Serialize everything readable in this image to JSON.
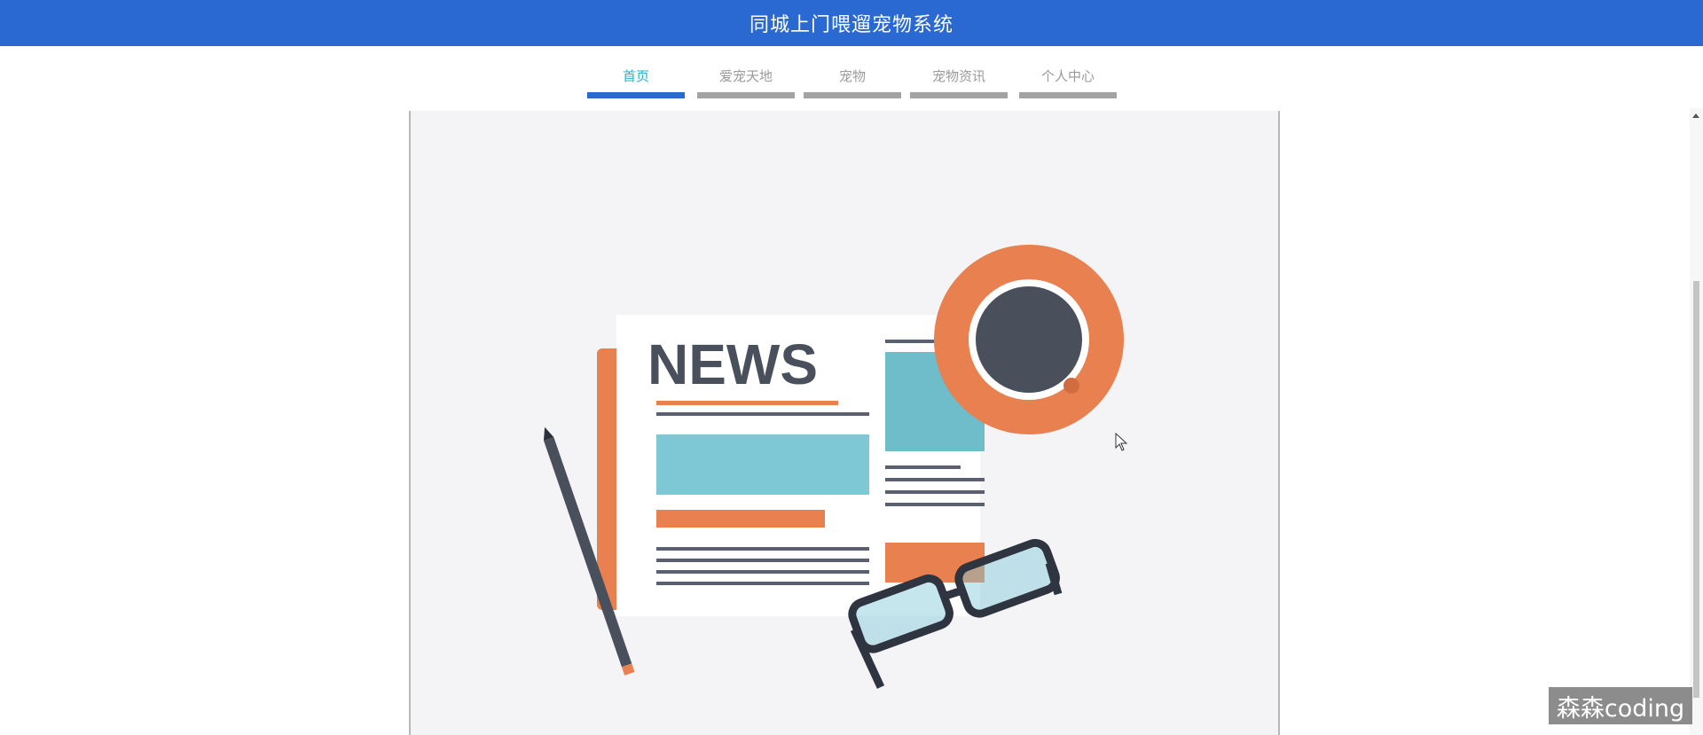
{
  "header": {
    "title": "同城上门喂遛宠物系统"
  },
  "nav": {
    "tabs": [
      {
        "label": "首页",
        "active": true
      },
      {
        "label": "爱宠天地",
        "active": false
      },
      {
        "label": "宠物",
        "active": false
      },
      {
        "label": "宠物资讯",
        "active": false
      },
      {
        "label": "个人中心",
        "active": false
      }
    ]
  },
  "banner": {
    "headline": "NEWS"
  },
  "watermark": {
    "text": "森森coding"
  },
  "colors": {
    "header_bg": "#2a69d1",
    "active_tab_text": "#2ab0c9",
    "active_tab_bar": "#2a69d1",
    "inactive_tab_bar": "#a3a3a3",
    "accent_orange": "#e8814f",
    "accent_teal": "#7ec8d6"
  },
  "icons": [
    "newspaper-illustration",
    "coffee-cup-icon",
    "pencil-icon",
    "glasses-icon",
    "mouse-cursor-icon"
  ]
}
